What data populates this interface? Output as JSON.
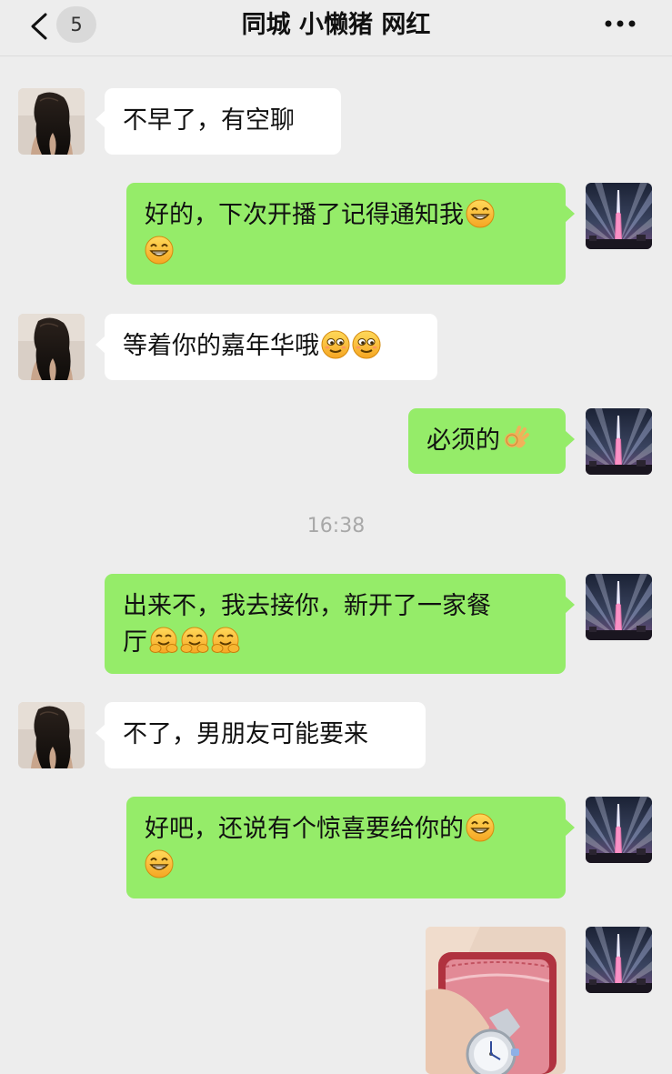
{
  "header": {
    "unread_count": "5",
    "title": "同城 小懒猪 网红"
  },
  "messages": [
    {
      "side": "left",
      "text": "不早了，有空聊",
      "emojis": []
    },
    {
      "side": "right",
      "text": "好的，下次开播了记得通知我",
      "emojis": [
        "grin-emoji",
        "grin-emoji"
      ]
    },
    {
      "side": "left",
      "text": "等着你的嘉年华哦",
      "emojis": [
        "smug-emoji",
        "smug-emoji"
      ]
    },
    {
      "side": "right",
      "text": "必须的",
      "emojis": [
        "ok-hand-emoji"
      ]
    },
    {
      "timestamp": "16:38"
    },
    {
      "side": "right",
      "text": "出来不，我去接你，新开了一家餐厅",
      "emojis": [
        "hug-emoji",
        "hug-emoji",
        "hug-emoji"
      ]
    },
    {
      "side": "left",
      "text": "不了，男朋友可能要来",
      "emojis": []
    },
    {
      "side": "right",
      "text": "好吧，还说有个惊喜要给你的",
      "emojis": [
        "grin-emoji",
        "grin-emoji"
      ]
    },
    {
      "side": "right",
      "image": "watch-in-box-photo"
    }
  ],
  "m": {
    "m1": "不早了，有空聊",
    "m2a": "好的，下次开播了记得通知我",
    "m3": "等着你的嘉年华哦",
    "m4": "必须的",
    "ts": "16:38",
    "m5a": "出来不，我去接你，新开了一家餐",
    "m5b": "厅",
    "m6": "不了，男朋友可能要来",
    "m7a": "好吧，还说有个惊喜要给你的"
  },
  "colors": {
    "background": "#ededed",
    "sent_bubble": "#95ec69",
    "received_bubble": "#ffffff",
    "timestamp": "#a8a8a8"
  }
}
